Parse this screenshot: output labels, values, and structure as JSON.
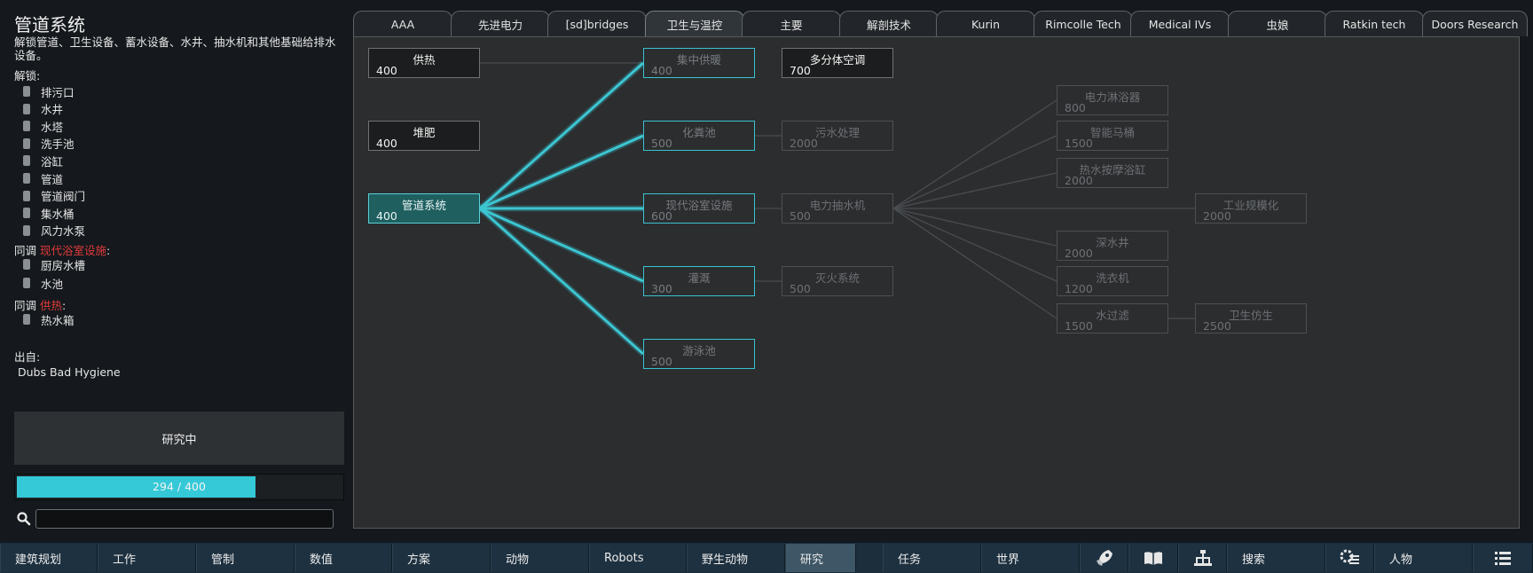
{
  "project": {
    "title": "管道系统",
    "description": "解锁管道、卫生设备、蓄水设备、水井、抽水机和其他基础给排水设备。",
    "unlocks_label": "解锁:",
    "unlocks": [
      {
        "label": "排污口",
        "icon": "sewage-outlet-icon"
      },
      {
        "label": "水井",
        "icon": "water-well-icon"
      },
      {
        "label": "水塔",
        "icon": "water-tower-icon"
      },
      {
        "label": "洗手池",
        "icon": "sink-icon"
      },
      {
        "label": "浴缸",
        "icon": "bathtub-icon"
      },
      {
        "label": "管道",
        "icon": "pipe-icon"
      },
      {
        "label": "管道阀门",
        "icon": "valve-icon"
      },
      {
        "label": "集水桶",
        "icon": "water-barrel-icon"
      },
      {
        "label": "风力水泵",
        "icon": "wind-pump-icon"
      }
    ],
    "with_groups": [
      {
        "prefix": "同调 ",
        "project": "现代浴室设施",
        "suffix": ":",
        "items": [
          {
            "label": "厨房水槽",
            "icon": "kitchen-sink-icon"
          },
          {
            "label": "水池",
            "icon": "basin-icon"
          }
        ]
      },
      {
        "prefix": "同调 ",
        "project": "供热",
        "suffix": ":",
        "items": [
          {
            "label": "热水箱",
            "icon": "water-heater-icon"
          }
        ]
      }
    ],
    "source_label": "出自:",
    "source": "Dubs Bad Hygiene",
    "research_button": "研究中",
    "progress_text": "294 / 400",
    "progress_fraction": 0.735,
    "search_placeholder": ""
  },
  "tabs": [
    {
      "label": "AAA",
      "active": false
    },
    {
      "label": "先进电力",
      "active": false
    },
    {
      "label": "[sd]bridges",
      "active": false
    },
    {
      "label": "卫生与温控",
      "active": true
    },
    {
      "label": "主要",
      "active": false
    },
    {
      "label": "解剖技术",
      "active": false
    },
    {
      "label": "Kurin",
      "active": false
    },
    {
      "label": "Rimcolle Tech",
      "active": false
    },
    {
      "label": "Medical IVs",
      "active": false
    },
    {
      "label": "虫娘",
      "active": false
    },
    {
      "label": "Ratkin tech",
      "active": false
    },
    {
      "label": "Doors Research",
      "active": false
    }
  ],
  "nodes": [
    {
      "id": "heating",
      "name": "供热",
      "cost": "400",
      "state": "done"
    },
    {
      "id": "compost",
      "name": "堆肥",
      "cost": "400",
      "state": "done"
    },
    {
      "id": "plumbing",
      "name": "管道系统",
      "cost": "400",
      "state": "current"
    },
    {
      "id": "central_heat",
      "name": "集中供暖",
      "cost": "400",
      "state": "avail"
    },
    {
      "id": "split_ac",
      "name": "多分体空调",
      "cost": "700",
      "state": "done"
    },
    {
      "id": "septic",
      "name": "化粪池",
      "cost": "500",
      "state": "avail"
    },
    {
      "id": "sewage",
      "name": "污水处理",
      "cost": "2000",
      "state": "locked"
    },
    {
      "id": "modern_bath",
      "name": "现代浴室设施",
      "cost": "600",
      "state": "avail"
    },
    {
      "id": "elec_pump",
      "name": "电力抽水机",
      "cost": "500",
      "state": "locked"
    },
    {
      "id": "irrigation",
      "name": "灌溉",
      "cost": "300",
      "state": "avail"
    },
    {
      "id": "fire",
      "name": "灭火系统",
      "cost": "500",
      "state": "locked"
    },
    {
      "id": "pool",
      "name": "游泳池",
      "cost": "500",
      "state": "avail"
    },
    {
      "id": "elec_shower",
      "name": "电力淋浴器",
      "cost": "800",
      "state": "locked"
    },
    {
      "id": "smart_toilet",
      "name": "智能马桶",
      "cost": "1500",
      "state": "locked"
    },
    {
      "id": "hot_tub",
      "name": "热水按摩浴缸",
      "cost": "2000",
      "state": "locked"
    },
    {
      "id": "deep_well",
      "name": "深水井",
      "cost": "2000",
      "state": "locked"
    },
    {
      "id": "washer",
      "name": "洗衣机",
      "cost": "1200",
      "state": "locked"
    },
    {
      "id": "water_filter",
      "name": "水过滤",
      "cost": "1500",
      "state": "locked"
    },
    {
      "id": "industrial",
      "name": "工业规模化",
      "cost": "2000",
      "state": "locked"
    },
    {
      "id": "hygiene_bionic",
      "name": "卫生仿生",
      "cost": "2500",
      "state": "locked"
    }
  ],
  "edges": [
    {
      "from": "heating",
      "to": "central_heat",
      "highlight": false
    },
    {
      "from": "plumbing",
      "to": "central_heat",
      "highlight": true
    },
    {
      "from": "plumbing",
      "to": "septic",
      "highlight": true
    },
    {
      "from": "plumbing",
      "to": "modern_bath",
      "highlight": true
    },
    {
      "from": "plumbing",
      "to": "irrigation",
      "highlight": true
    },
    {
      "from": "plumbing",
      "to": "pool",
      "highlight": true
    },
    {
      "from": "septic",
      "to": "sewage",
      "highlight": false
    },
    {
      "from": "modern_bath",
      "to": "elec_pump",
      "highlight": false
    },
    {
      "from": "irrigation",
      "to": "fire",
      "highlight": false
    },
    {
      "from": "elec_pump",
      "to": "elec_shower",
      "highlight": false
    },
    {
      "from": "elec_pump",
      "to": "smart_toilet",
      "highlight": false
    },
    {
      "from": "elec_pump",
      "to": "hot_tub",
      "highlight": false
    },
    {
      "from": "elec_pump",
      "to": "industrial",
      "highlight": false
    },
    {
      "from": "elec_pump",
      "to": "deep_well",
      "highlight": false
    },
    {
      "from": "elec_pump",
      "to": "washer",
      "highlight": false
    },
    {
      "from": "elec_pump",
      "to": "water_filter",
      "highlight": false
    },
    {
      "from": "water_filter",
      "to": "hygiene_bionic",
      "highlight": false
    }
  ],
  "bottombar": [
    {
      "label": "建筑规划",
      "name": "bottom-architect-button"
    },
    {
      "label": "工作",
      "name": "bottom-work-button"
    },
    {
      "label": "管制",
      "name": "bottom-restrict-button"
    },
    {
      "label": "数值",
      "name": "bottom-assign-button"
    },
    {
      "label": "方案",
      "name": "bottom-policy-button"
    },
    {
      "label": "动物",
      "name": "bottom-animals-button"
    },
    {
      "label": "Robots",
      "name": "bottom-robots-button"
    },
    {
      "label": "野生动物",
      "name": "bottom-wildlife-button"
    },
    {
      "label": "研究",
      "name": "bottom-research-button",
      "active": true
    },
    {
      "label": "任务",
      "name": "bottom-quests-button"
    },
    {
      "label": "世界",
      "name": "bottom-world-button"
    },
    {
      "label": "",
      "name": "bottom-rocket-button",
      "icon": "rocket-icon"
    },
    {
      "label": "",
      "name": "bottom-book-button",
      "icon": "book-icon"
    },
    {
      "label": "",
      "name": "bottom-faction-button",
      "icon": "faction-icon"
    },
    {
      "label": "搜索",
      "name": "bottom-search-button"
    },
    {
      "label": "",
      "name": "bottom-gear-list-button",
      "icon": "gear-list-icon"
    },
    {
      "label": "人物",
      "name": "bottom-pawns-button"
    },
    {
      "label": "",
      "name": "bottom-menu-button",
      "icon": "menu-icon"
    }
  ],
  "colors": {
    "accent": "#35c9d8",
    "current_node": "#1f5f60",
    "highlight_line": "#3cc6d2",
    "locked_line": "#4a4d50",
    "with_project": "#e23a3a"
  }
}
